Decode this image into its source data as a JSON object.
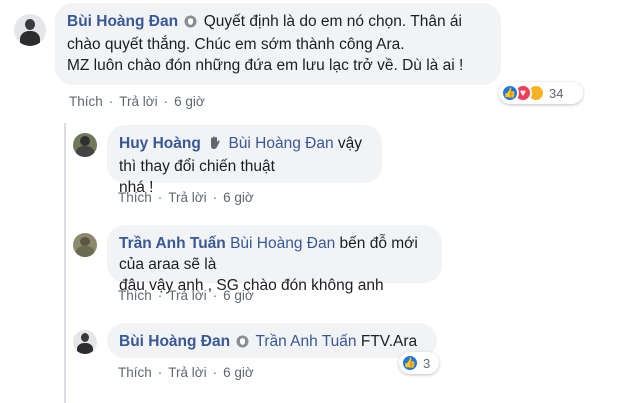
{
  "comment_main": {
    "author": "Bùi Hoàng Đan",
    "text": "Quyết định là do em nó chọn. Thân ái chào quyết thắng. Chúc em sớm thành công Ara.",
    "text2": "MZ luôn chào đón những đứa em lưu lạc trở về. Dù là ai !",
    "like_label": "Thích",
    "reply_label": "Trả lời",
    "time": "6 giờ",
    "reaction_count": "34",
    "reaction_icons": [
      "like-icon",
      "love-icon",
      "sad-icon"
    ]
  },
  "replies": [
    {
      "author": "Huy Hoàng",
      "tag": "Bùi Hoàng Đan",
      "text": "vậy thì thay đổi chiến thuật",
      "text2": "nhá !",
      "like_label": "Thích",
      "reply_label": "Trả lời",
      "time": "6 giờ"
    },
    {
      "author": "Trần Anh Tuấn",
      "tag": "Bùi Hoàng Đan",
      "text": "bến đỗ mới của araa sẽ là",
      "text2": "đâu vậy anh , SG chào đón không anh",
      "like_label": "Thích",
      "reply_label": "Trả lời",
      "time": "6 giờ"
    },
    {
      "author": "Bùi Hoàng Đan",
      "tag": "Trần Anh Tuấn",
      "text": "FTV.Ara",
      "like_label": "Thích",
      "reply_label": "Trả lời",
      "time": "6 giờ",
      "reaction_count": "3",
      "reaction_icons": [
        "like-icon"
      ]
    }
  ],
  "colors": {
    "name": "#385898",
    "bubble": "#f2f3f5",
    "meta": "#606770",
    "like": "#1877f2",
    "love": "#f33e58",
    "sad": "#f7b125"
  }
}
